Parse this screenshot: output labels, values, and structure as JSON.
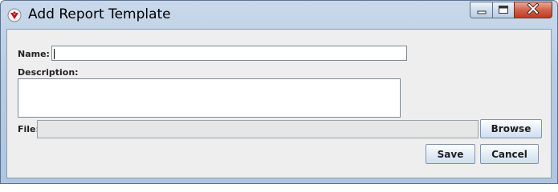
{
  "window": {
    "title": "Add Report Template"
  },
  "form": {
    "name_label": "Name:",
    "name_value": "",
    "description_label": "Description:",
    "description_value": "",
    "file_label": "File:",
    "file_value": ""
  },
  "buttons": {
    "browse": "Browse",
    "save": "Save",
    "cancel": "Cancel"
  },
  "icons": {
    "app": "app-shield-icon",
    "minimize": "minimize-icon",
    "maximize": "maximize-icon",
    "close": "close-icon"
  },
  "colors": {
    "close_button": "#c94a31",
    "titlebar": "#b8cde3",
    "dialog_bg": "#eeeeee"
  }
}
